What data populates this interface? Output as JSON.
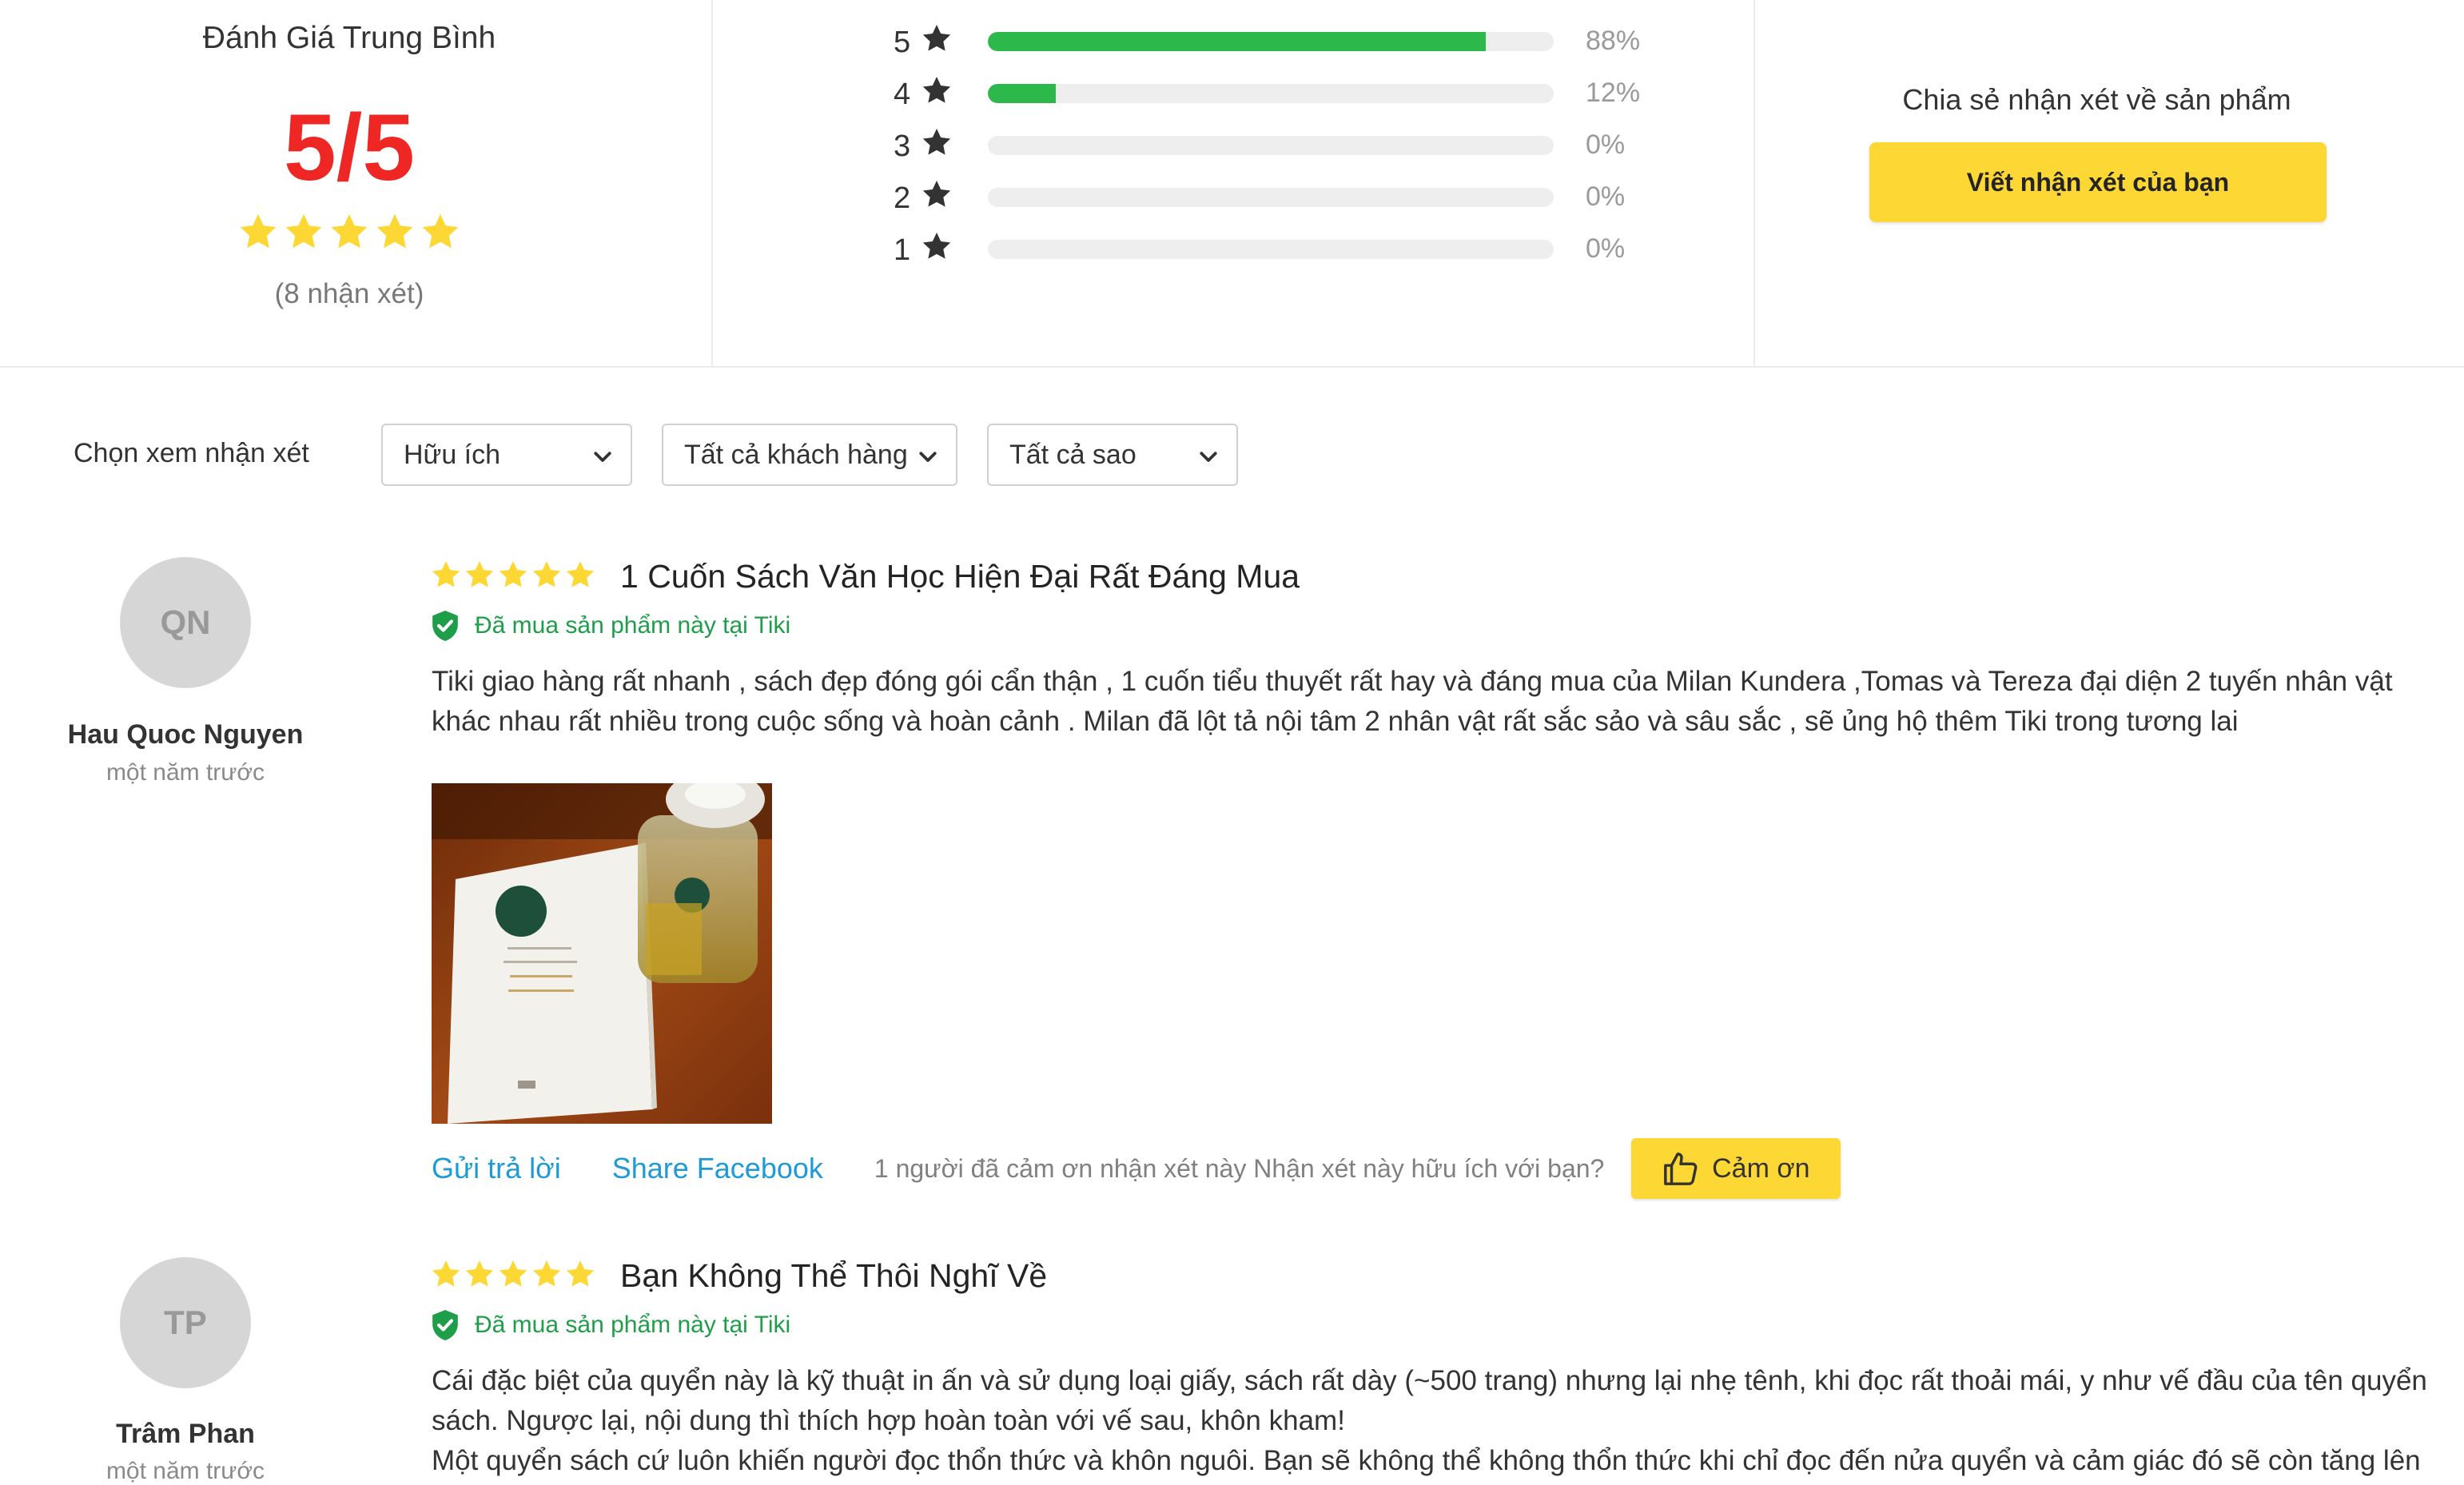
{
  "summary": {
    "title": "Đánh Giá Trung Bình",
    "average": "5/5",
    "average_rating": 5,
    "count_text": "(8 nhận xét)",
    "distribution": [
      {
        "stars": "5",
        "percent_text": "88%",
        "percent": 88
      },
      {
        "stars": "4",
        "percent_text": "12%",
        "percent": 12
      },
      {
        "stars": "3",
        "percent_text": "0%",
        "percent": 0
      },
      {
        "stars": "2",
        "percent_text": "0%",
        "percent": 0
      },
      {
        "stars": "1",
        "percent_text": "0%",
        "percent": 0
      }
    ],
    "share_title": "Chia sẻ nhận xét về sản phẩm",
    "share_button": "Viết nhận xét của bạn"
  },
  "filters": {
    "label": "Chọn xem nhận xét",
    "selects": [
      {
        "value": "Hữu ích"
      },
      {
        "value": "Tất cả khách hàng"
      },
      {
        "value": "Tất cả sao"
      }
    ]
  },
  "reviews": [
    {
      "initials": "QN",
      "name": "Hau Quoc Nguyen",
      "time": "một năm trước",
      "rating": 5,
      "title": "1 Cuốn Sách Văn Học Hiện Đại Rất Đáng Mua",
      "badge": "Đã mua sản phẩm này tại Tiki",
      "text": "Tiki giao hàng rất nhanh , sách đẹp đóng gói cẩn thận , 1 cuốn tiểu thuyết rất hay và đáng mua của Milan Kundera ,Tomas và Tereza đại diện 2 tuyến nhân vật khác nhau rất nhiều trong cuộc sống và hoàn cảnh . Milan đã lột tả nội tâm 2 nhân vật rất sắc sảo và sâu sắc , sẽ ủng hộ thêm Tiki trong tương lai",
      "reply_link": "Gửi trả lời",
      "share_link": "Share Facebook",
      "thanks_text": "1 người đã cảm ơn nhận xét này Nhận xét này hữu ích với bạn?",
      "thanks_button": "Cảm ơn"
    },
    {
      "initials": "TP",
      "name": "Trâm Phan",
      "time": "một năm trước",
      "rating": 5,
      "title": "Bạn Không Thể Thôi Nghĩ Về",
      "badge": "Đã mua sản phẩm này tại Tiki",
      "text_lines": [
        "Cái đặc biệt của quyển này là kỹ thuật in ấn và sử dụng loại giấy, sách rất dày (~500 trang) nhưng lại nhẹ tênh, khi đọc rất thoải mái, y như vế đầu của tên quyển sách. Ngược lại, nội dung thì thích hợp hoàn toàn với vế sau, khôn kham!",
        "Một quyển sách cứ luôn khiến người đọc thổn thức và khôn nguôi. Bạn sẽ không thể không thổn thức khi chỉ đọc đến nửa quyển và cảm giác đó sẽ còn tăng lên"
      ]
    }
  ],
  "colors": {
    "star": "#fdd835",
    "star_gray": "#333333",
    "bar_fill": "#2db84b",
    "average": "#ee2624",
    "button": "#fdd835",
    "link": "#1e9ad6",
    "verified": "#1f9e4a"
  },
  "icons": {
    "star": "star-icon",
    "chevron": "chevron-down-icon",
    "verified": "shield-check-icon",
    "thanks": "thumbs-up-icon"
  }
}
